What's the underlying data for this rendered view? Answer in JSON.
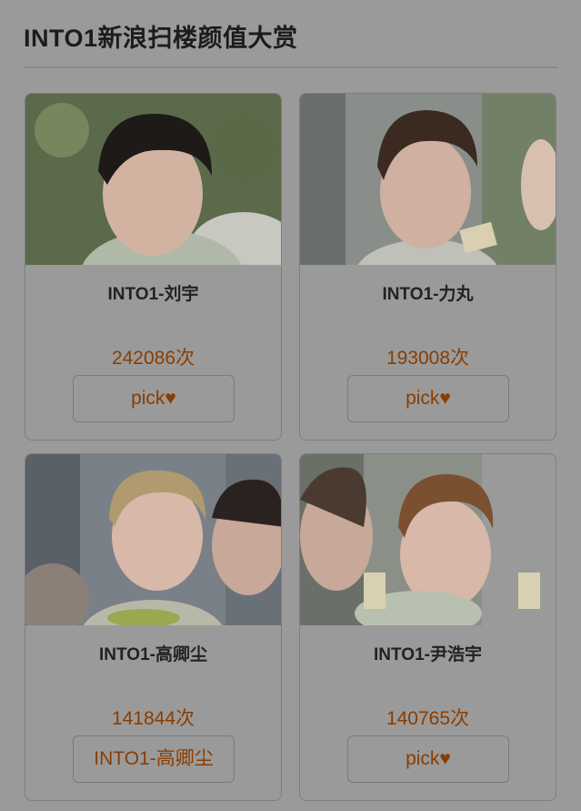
{
  "page": {
    "title": "INTO1新浪扫楼颜值大赏"
  },
  "cards": [
    {
      "name": "INTO1-刘宇",
      "count": "242086次",
      "button": "pick♥"
    },
    {
      "name": "INTO1-力丸",
      "count": "193008次",
      "button": "pick♥"
    },
    {
      "name": "INTO1-高卿尘",
      "count": "141844次",
      "button": "INTO1-高卿尘"
    },
    {
      "name": "INTO1-尹浩宇",
      "count": "140765次",
      "button": "pick♥"
    }
  ],
  "colors": {
    "overlay_background": "#9a9a9a",
    "count_text": "#8a3d00",
    "title_text": "#1c1c1c"
  }
}
